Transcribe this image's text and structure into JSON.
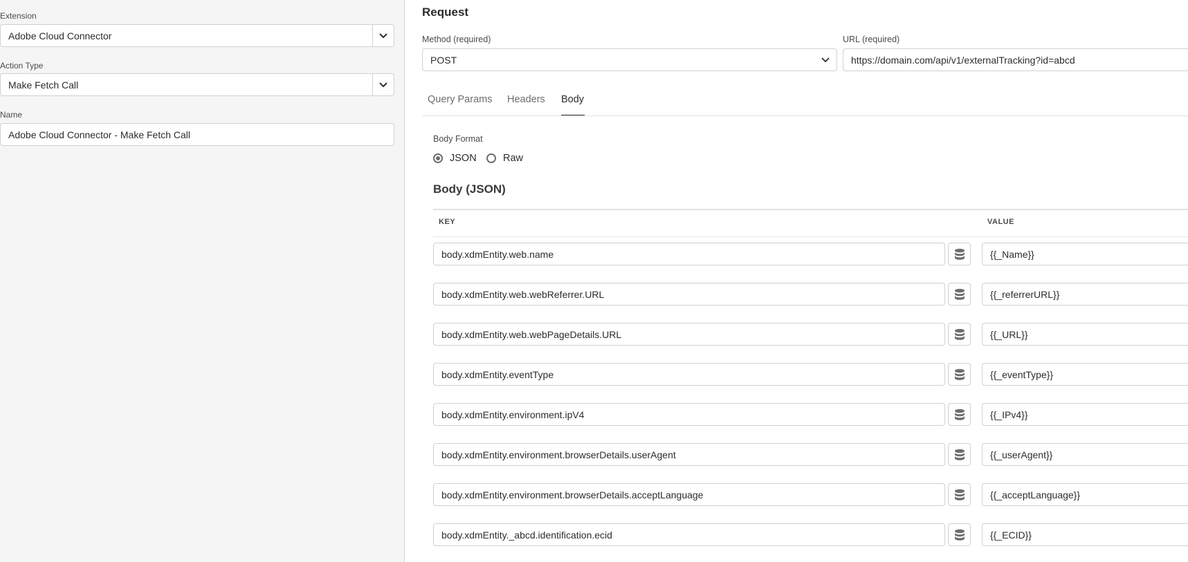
{
  "left": {
    "extension": {
      "label": "Extension",
      "value": "Adobe Cloud Connector"
    },
    "action_type": {
      "label": "Action Type",
      "value": "Make Fetch Call"
    },
    "name": {
      "label": "Name",
      "value": "Adobe Cloud Connector - Make Fetch Call"
    }
  },
  "request": {
    "title": "Request",
    "method": {
      "label": "Method (required)",
      "value": "POST"
    },
    "url": {
      "label": "URL (required)",
      "value": "https://domain.com/api/v1/externalTracking?id=abcd"
    }
  },
  "tabs": [
    {
      "label": "Query Params"
    },
    {
      "label": "Headers"
    },
    {
      "label": "Body",
      "active": true
    }
  ],
  "body_format": {
    "label": "Body Format",
    "options": [
      {
        "label": "JSON",
        "selected": true
      },
      {
        "label": "Raw",
        "selected": false
      }
    ]
  },
  "body_json": {
    "title": "Body (JSON)",
    "key_header": "KEY",
    "value_header": "VALUE",
    "rows": [
      {
        "key": "body.xdmEntity.web.name",
        "value": "{{_Name}}"
      },
      {
        "key": "body.xdmEntity.web.webReferrer.URL",
        "value": "{{_referrerURL}}"
      },
      {
        "key": "body.xdmEntity.web.webPageDetails.URL",
        "value": "{{_URL}}"
      },
      {
        "key": "body.xdmEntity.eventType",
        "value": "{{_eventType}}"
      },
      {
        "key": "body.xdmEntity.environment.ipV4",
        "value": "{{_IPv4}}"
      },
      {
        "key": "body.xdmEntity.environment.browserDetails.userAgent",
        "value": "{{_userAgent}}"
      },
      {
        "key": "body.xdmEntity.environment.browserDetails.acceptLanguage",
        "value": "{{_acceptLanguage}}"
      },
      {
        "key": "body.xdmEntity._abcd.identification.ecid",
        "value": "{{_ECID}}"
      }
    ]
  },
  "icons": {
    "dropdown": "chevron-down-icon",
    "data_element": "database-icon"
  },
  "colors": {
    "panel_bg": "#f5f5f5",
    "text": "#2c2c2c",
    "border": "#d0d0d0"
  }
}
